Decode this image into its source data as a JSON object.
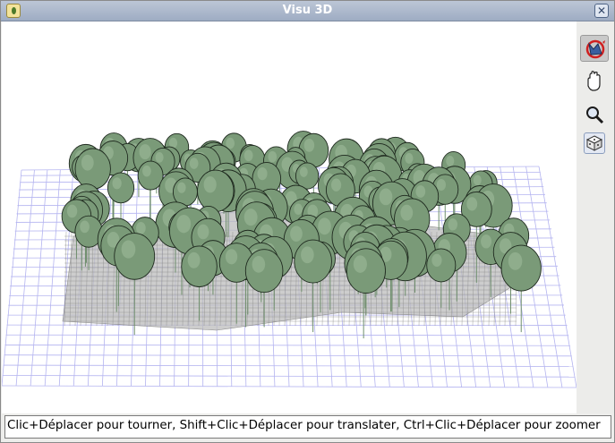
{
  "window": {
    "title": "Visu 3D",
    "close_glyph": "✕"
  },
  "toolbar": {
    "tools": [
      {
        "name": "rotate-icon",
        "active": true
      },
      {
        "name": "pan-hand-icon",
        "active": false
      },
      {
        "name": "zoom-icon",
        "active": false
      },
      {
        "name": "dice-icon",
        "active": false
      }
    ]
  },
  "statusbar": {
    "text": "Clic+Déplacer pour tourner, Shift+Clic+Déplacer pour translater, Ctrl+Clic+Déplacer pour zoomer"
  },
  "scene": {
    "grid_color": "#b4b4f0",
    "crown_color": "#7a9a78",
    "crown_stroke": "#1f2a1f",
    "stem_color": "#6f8f6d",
    "terrain_color": "#bdbdbd"
  }
}
